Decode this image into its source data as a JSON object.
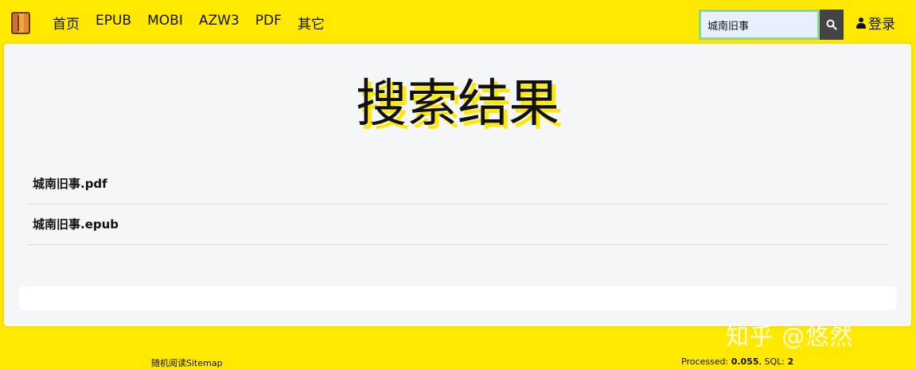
{
  "nav": {
    "links": [
      "首页",
      "EPUB",
      "MOBI",
      "AZW3",
      "PDF",
      "其它"
    ],
    "search_value": "城南旧事",
    "login_label": "登录"
  },
  "main": {
    "title": "搜索结果",
    "results": [
      "城南旧事.pdf",
      "城南旧事.epub"
    ]
  },
  "footer": {
    "link": "随机阅读Sitemap",
    "processed_label": "Processed: ",
    "processed_value": "0.055",
    "sql_label": ", SQL: ",
    "sql_value": "2"
  },
  "watermark": "知乎 @悠然",
  "colors": {
    "background": "#ffe900",
    "search_button": "#444444"
  }
}
